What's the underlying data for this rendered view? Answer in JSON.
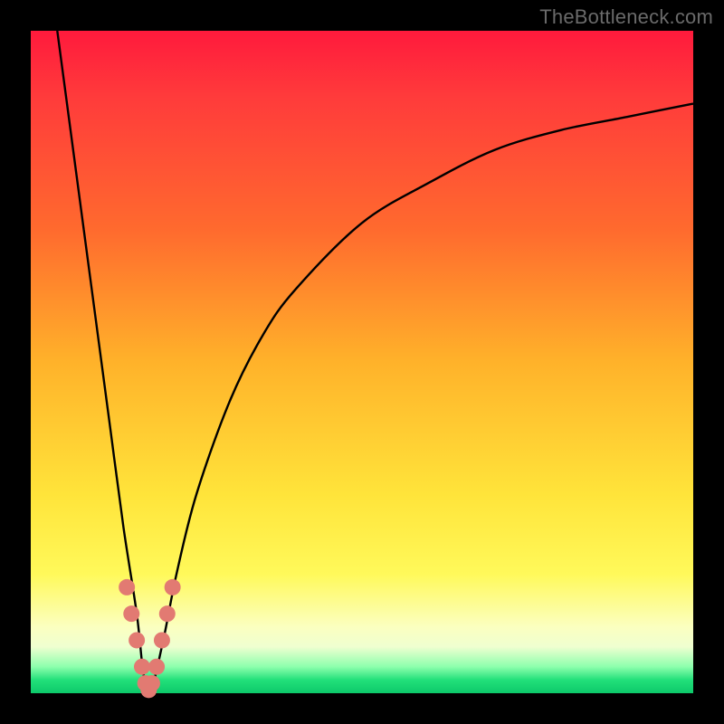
{
  "watermark": {
    "text": "TheBottleneck.com"
  },
  "colors": {
    "frame": "#000000",
    "curve": "#000000",
    "marker": "#e27a72",
    "gradient_stops": [
      "#ff1a3c",
      "#ff6a2e",
      "#ffb22a",
      "#ffe43a",
      "#fbffc0",
      "#22e07a"
    ]
  },
  "chart_data": {
    "type": "line",
    "title": "",
    "xlabel": "",
    "ylabel": "",
    "xlim": [
      0,
      100
    ],
    "ylim": [
      0,
      100
    ],
    "grid": false,
    "legend": false,
    "series": [
      {
        "name": "bottleneck-curve",
        "x": [
          4,
          6,
          8,
          10,
          12,
          14,
          16,
          17,
          18,
          20,
          22,
          25,
          30,
          35,
          40,
          50,
          60,
          70,
          80,
          90,
          100
        ],
        "y": [
          100,
          85,
          70,
          55,
          40,
          25,
          12,
          3,
          0,
          8,
          18,
          30,
          44,
          54,
          61,
          71,
          77,
          82,
          85,
          87,
          89
        ]
      }
    ],
    "markers": [
      {
        "name": "near-minimum-dots",
        "x": [
          14.5,
          15.2,
          16.0,
          16.8,
          17.3,
          17.8,
          18.3,
          19.0,
          19.8,
          20.6,
          21.4
        ],
        "y": [
          16,
          12,
          8,
          4,
          1.5,
          0.5,
          1.5,
          4,
          8,
          12,
          16
        ]
      }
    ],
    "minimum": {
      "x": 18,
      "y": 0
    }
  }
}
